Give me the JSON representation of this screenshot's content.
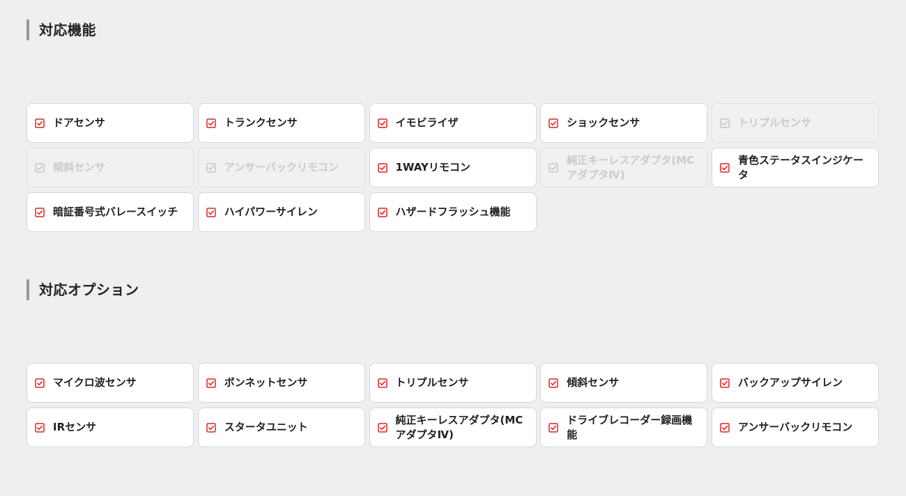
{
  "colors": {
    "accent": "#e02121",
    "disabled": "#c6c6c6",
    "page_background": "#efefef",
    "card_background": "#ffffff"
  },
  "sections": [
    {
      "title": "対応機能",
      "items": [
        {
          "label": "ドアセンサ",
          "checked": true,
          "enabled": true
        },
        {
          "label": "トランクセンサ",
          "checked": true,
          "enabled": true
        },
        {
          "label": "イモビライザ",
          "checked": true,
          "enabled": true
        },
        {
          "label": "ショックセンサ",
          "checked": true,
          "enabled": true
        },
        {
          "label": "トリプルセンサ",
          "checked": true,
          "enabled": false
        },
        {
          "label": "傾斜センサ",
          "checked": true,
          "enabled": false
        },
        {
          "label": "アンサーバックリモコン",
          "checked": true,
          "enabled": false
        },
        {
          "label": "1WAYリモコン",
          "checked": true,
          "enabled": true
        },
        {
          "label": "純正キーレスアダプタ(MCアダプタⅣ)",
          "checked": true,
          "enabled": false
        },
        {
          "label": "青色ステータスインジケータ",
          "checked": true,
          "enabled": true
        },
        {
          "label": "暗証番号式バレースイッチ",
          "checked": true,
          "enabled": true
        },
        {
          "label": "ハイパワーサイレン",
          "checked": true,
          "enabled": true
        },
        {
          "label": "ハザードフラッシュ機能",
          "checked": true,
          "enabled": true
        }
      ]
    },
    {
      "title": "対応オプション",
      "items": [
        {
          "label": "マイクロ波センサ",
          "checked": true,
          "enabled": true
        },
        {
          "label": "ボンネットセンサ",
          "checked": true,
          "enabled": true
        },
        {
          "label": "トリプルセンサ",
          "checked": true,
          "enabled": true
        },
        {
          "label": "傾斜センサ",
          "checked": true,
          "enabled": true
        },
        {
          "label": "バックアップサイレン",
          "checked": true,
          "enabled": true
        },
        {
          "label": "IRセンサ",
          "checked": true,
          "enabled": true
        },
        {
          "label": "スタータユニット",
          "checked": true,
          "enabled": true
        },
        {
          "label": "純正キーレスアダプタ(MCアダプタⅣ)",
          "checked": true,
          "enabled": true
        },
        {
          "label": "ドライブレコーダー録画機能",
          "checked": true,
          "enabled": true
        },
        {
          "label": "アンサーバックリモコン",
          "checked": true,
          "enabled": true
        }
      ]
    }
  ]
}
